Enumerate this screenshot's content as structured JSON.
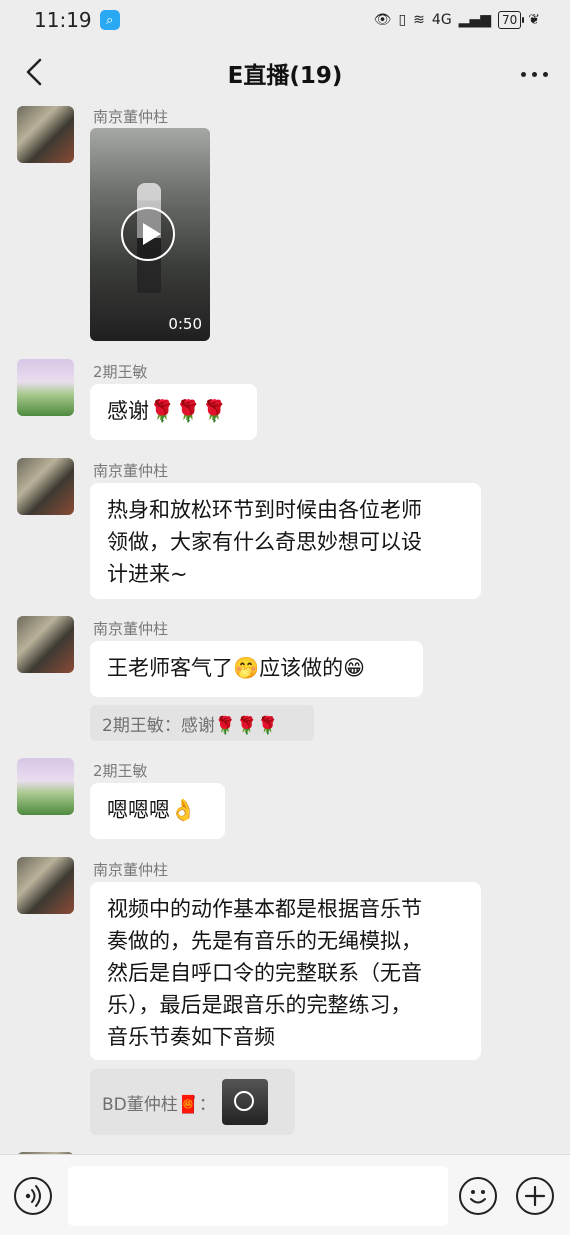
{
  "status_bar": {
    "time": "11:19",
    "network": "4G",
    "battery": "70"
  },
  "nav": {
    "title": "E直播(19)"
  },
  "messages": [
    {
      "sender": "南京董仲柱",
      "type": "video",
      "duration": "0:50"
    },
    {
      "sender": "2期王敏",
      "text": "感谢🌹🌹🌹"
    },
    {
      "sender": "南京董仲柱",
      "lines": [
        "热身和放松环节到时候由各位老师",
        "领做，大家有什么奇思妙想可以设",
        "计进来~"
      ]
    },
    {
      "sender": "南京董仲柱",
      "text": "王老师客气了🤭应该做的😁",
      "quote": "2期王敏：感谢🌹🌹🌹"
    },
    {
      "sender": "2期王敏",
      "text": "嗯嗯嗯👌"
    },
    {
      "sender": "南京董仲柱",
      "lines": [
        "视频中的动作基本都是根据音乐节",
        "奏做的，先是有音乐的无绳模拟，",
        "然后是自呼口令的完整联系（无音",
        "乐），最后是跟音乐的完整练习，",
        "音乐节奏如下音频"
      ],
      "quote": "BD董仲柱🧧："
    }
  ],
  "input": {
    "placeholder": ""
  },
  "icons": {
    "back": "chevron-left-icon",
    "more": "more-dots-icon",
    "voice": "voice-icon",
    "emoji": "smiley-icon",
    "plus": "plus-icon"
  }
}
